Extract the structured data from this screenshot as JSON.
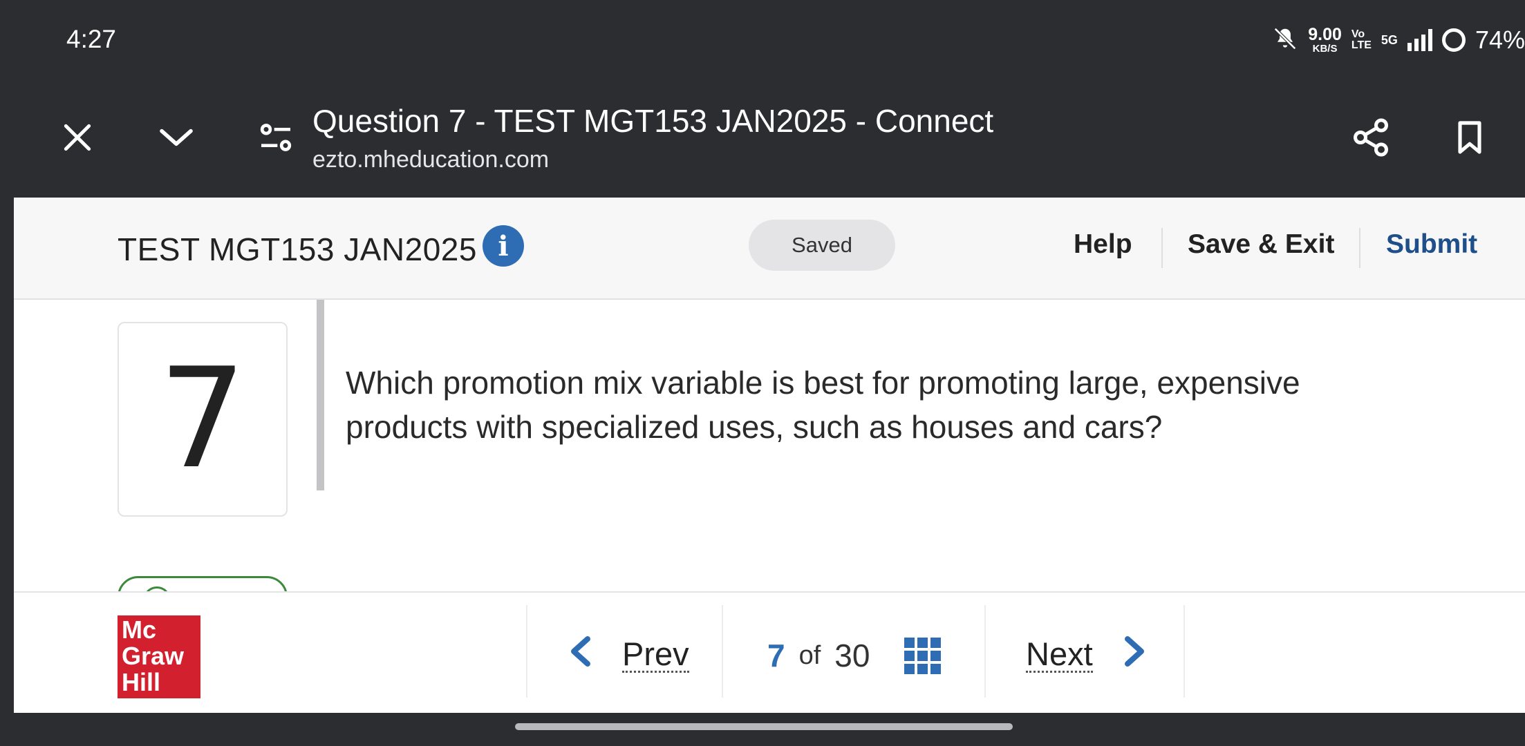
{
  "status_bar": {
    "time": "4:27",
    "net_speed_value": "9.00",
    "net_speed_unit": "KB/S",
    "volte_top": "Vo",
    "volte_bottom": "LTE",
    "network": "5G",
    "battery": "74%"
  },
  "browser": {
    "tab_title": "Question 7 - TEST MGT153 JAN2025 - Connect",
    "url": "ezto.mheducation.com"
  },
  "header": {
    "test_title": "TEST MGT153 JAN2025",
    "saved_status": "Saved",
    "help_label": "Help",
    "save_exit_label": "Save & Exit",
    "submit_label": "Submit"
  },
  "question": {
    "number": "7",
    "text": "Which promotion mix variable is best for promoting large, expensive products with specialized uses, such as houses and cars?"
  },
  "footer": {
    "logo_lines": [
      "Mc",
      "Graw",
      "Hill"
    ],
    "prev_label": "Prev",
    "current_page": "7",
    "of_label": "of",
    "total_pages": "30",
    "next_label": "Next"
  },
  "colors": {
    "accent_blue": "#2e6db4",
    "submit_blue": "#1f4f8a",
    "brand_red": "#d2202f",
    "chrome_dark": "#2b2d30"
  }
}
